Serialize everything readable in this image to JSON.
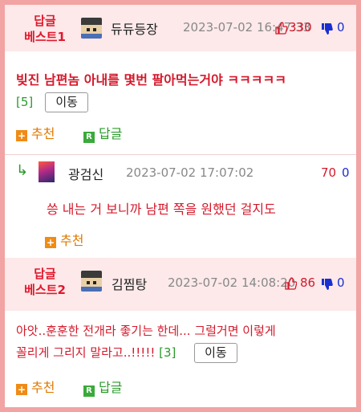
{
  "comments": [
    {
      "best_label_1": "답글",
      "best_label_2": "베스트1",
      "nick": "듀듀등장",
      "date": "2023-07-02 16:47:33",
      "up": "330",
      "down": "0",
      "text": "빚진 남편놈 아내를 몇번 팔아먹는거야 ㅋㅋㅋㅋㅋ",
      "reply_count": "[5]",
      "move_label": "이동",
      "recommend_label": "추천",
      "reply_label": "답글"
    },
    {
      "nick": "광검신",
      "date": "2023-07-02 17:07:02",
      "up": "70",
      "down": "0",
      "text": "씅 내는 거 보니까 남편 쪽을 원했던 걸지도",
      "recommend_label": "추천"
    },
    {
      "best_label_1": "답글",
      "best_label_2": "베스트2",
      "nick": "김찜탕",
      "date": "2023-07-02 14:08:20",
      "up": "86",
      "down": "0",
      "text_line1": "아앗..훈훈한 전개라 좋기는 한데... 그럴거면 이렇게",
      "text_line2": "꼴리게 그리지 말라고..!!!!!",
      "reply_count": "[3]",
      "move_label": "이동",
      "recommend_label": "추천",
      "reply_label": "답글"
    }
  ],
  "icons": {
    "plus_glyph": "+",
    "reply_glyph": "R",
    "reply_arrow": "↳"
  },
  "colors": {
    "accent": "#e0182c",
    "frame": "#f2a3a3",
    "best_bg": "#fde9ea"
  }
}
